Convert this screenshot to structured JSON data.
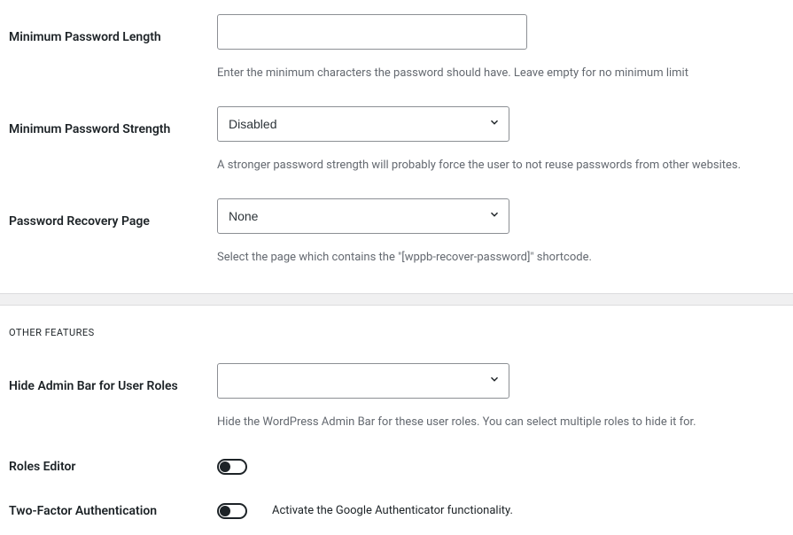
{
  "fields": {
    "min_pw_length": {
      "label": "Minimum Password Length",
      "value": "",
      "help": "Enter the minimum characters the password should have. Leave empty for no minimum limit"
    },
    "min_pw_strength": {
      "label": "Minimum Password Strength",
      "value": "Disabled",
      "help": "A stronger password strength will probably force the user to not reuse passwords from other websites."
    },
    "recovery_page": {
      "label": "Password Recovery Page",
      "value": "None",
      "help": "Select the page which contains the \"[wppb-recover-password]\" shortcode."
    }
  },
  "section_heading": "OTHER FEATURES",
  "other": {
    "hide_admin_bar": {
      "label": "Hide Admin Bar for User Roles",
      "value": "",
      "help": "Hide the WordPress Admin Bar for these user roles. You can select multiple roles to hide it for."
    },
    "roles_editor": {
      "label": "Roles Editor",
      "enabled": false
    },
    "two_factor": {
      "label": "Two-Factor Authentication",
      "enabled": false,
      "desc": "Activate the Google Authenticator functionality."
    }
  }
}
